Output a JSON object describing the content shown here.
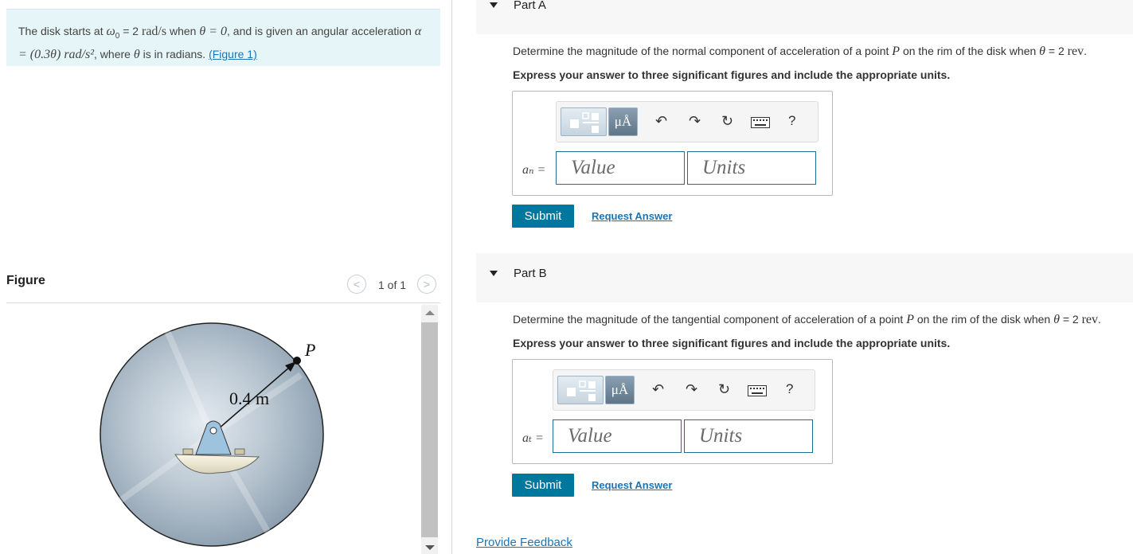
{
  "problem": {
    "text_1": "The disk starts at ",
    "omega0": "ω",
    "omega0_sub": "0",
    "text_2": " = 2 ",
    "omega_unit": "rad/s",
    "text_3": " when ",
    "theta0": "θ = 0",
    "text_4": ", and is given an angular acceleration ",
    "alpha_expr": "α = (0.3θ) rad/s²",
    "text_5": ", where ",
    "theta": "θ",
    "text_6": " is in radians. ",
    "figure_link": "(Figure 1)"
  },
  "figure": {
    "title": "Figure",
    "counter": "1 of 1",
    "prev_glyph": "<",
    "next_glyph": ">",
    "radius_label": "0.4 m",
    "point_label": "P"
  },
  "partA": {
    "title": "Part A",
    "question_pre": "Determine the magnitude of the normal component of acceleration of a point ",
    "point": "P",
    "question_post": " on the rim of the disk when ",
    "theta": "θ",
    "question_val": " = 2 ",
    "rev": "rev",
    "instruction": "Express your answer to three significant figures and include the appropriate units.",
    "var_label": "aₙ =",
    "value_placeholder": "Value",
    "units_placeholder": "Units",
    "submit_label": "Submit",
    "request_label": "Request Answer"
  },
  "partB": {
    "title": "Part B",
    "question_pre": "Determine the magnitude of the tangential component of acceleration of a point ",
    "point": "P",
    "question_post": " on the rim of the disk when ",
    "theta": "θ",
    "question_val": " = 2 ",
    "rev": "rev",
    "instruction": "Express your answer to three significant figures and include the appropriate units.",
    "var_label": "aₜ =",
    "value_placeholder": "Value",
    "units_placeholder": "Units",
    "submit_label": "Submit",
    "request_label": "Request Answer"
  },
  "toolbar": {
    "units_symbol": "μÅ",
    "undo_icon": "↶",
    "redo_icon": "↷",
    "reset_icon": "↻",
    "help_label": "?"
  },
  "feedback_label": "Provide Feedback"
}
